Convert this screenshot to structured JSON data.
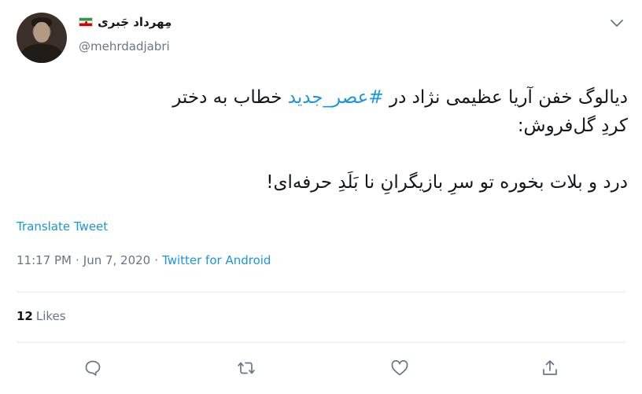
{
  "author": {
    "display_name": "مِهرداد جَبری",
    "username": "@mehrdadjabri",
    "avatar_icon": "profile-photo",
    "flag_icon": "iran-flag"
  },
  "tweet": {
    "text_before_hashtag": "دیالوگ خفن آریا عظیمی نژاد در ",
    "hashtag": "#عصر_جدید",
    "text_after_hashtag": " خطاب به دختر کردِ گل‌فروش:\n\nدرد و بلات بخوره تو سرِ بازیگرانِ نا بَلَدِ حرفه‌ای!"
  },
  "translate_label": "Translate Tweet",
  "meta": {
    "time": "11:17 PM",
    "sep1": "·",
    "date": "Jun 7, 2020",
    "sep2": "·",
    "source": "Twitter for Android"
  },
  "stats": {
    "likes_count": "12",
    "likes_label": "Likes"
  },
  "actions": {
    "reply_icon": "reply-icon",
    "retweet_icon": "retweet-icon",
    "like_icon": "heart-icon",
    "share_icon": "share-icon"
  },
  "colors": {
    "link": "#1b95e0",
    "secondary_text": "#657786",
    "primary_text": "#14171a",
    "divider": "#e6ecf0"
  }
}
